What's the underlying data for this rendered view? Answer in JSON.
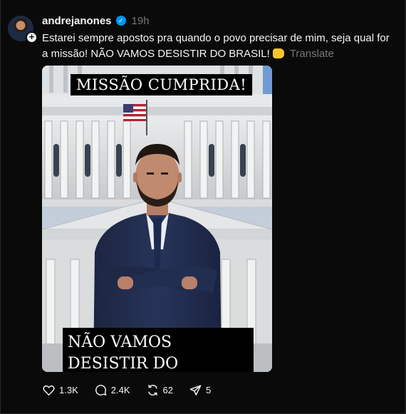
{
  "post": {
    "username": "andrejanones",
    "time": "19h",
    "caption_text": "Estarei sempre apostos pra quando o povo precisar de mim, seja qual for a missão! NÃO VAMOS DESISTIR DO BRASIL!",
    "translate_label": "Translate",
    "media": {
      "top_text": "MISSÃO CUMPRIDA!",
      "bottom_text": "NÃO VAMOS DESISTIR DO BRASIL!"
    },
    "actions": {
      "likes": "1.3K",
      "replies": "2.4K",
      "reposts": "62",
      "shares": "5"
    }
  },
  "icons": [
    "plus-icon",
    "verified-badge-icon",
    "fist-emoji-icon",
    "brazil-flag-icon",
    "heart-icon",
    "comment-icon",
    "repost-icon",
    "share-icon"
  ],
  "colors": {
    "background": "#0a0a0a",
    "text": "#f3f5f7",
    "muted": "#777777",
    "verified": "#0095f6"
  }
}
